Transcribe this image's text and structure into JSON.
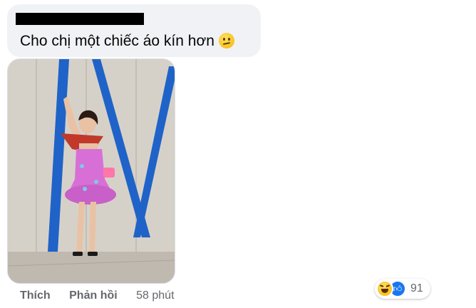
{
  "comment": {
    "text": "Cho chị một chiếc áo kín hơn",
    "emoji": "confused-face-icon"
  },
  "actions": {
    "like_label": "Thích",
    "reply_label": "Phản hồi",
    "timestamp": "58 phút"
  },
  "reactions": {
    "icons": [
      "haha-icon",
      "like-icon"
    ],
    "count": "91"
  },
  "colors": {
    "bubble": "#f0f2f5",
    "muted_text": "#65676b",
    "like_blue": "#1877f2"
  }
}
